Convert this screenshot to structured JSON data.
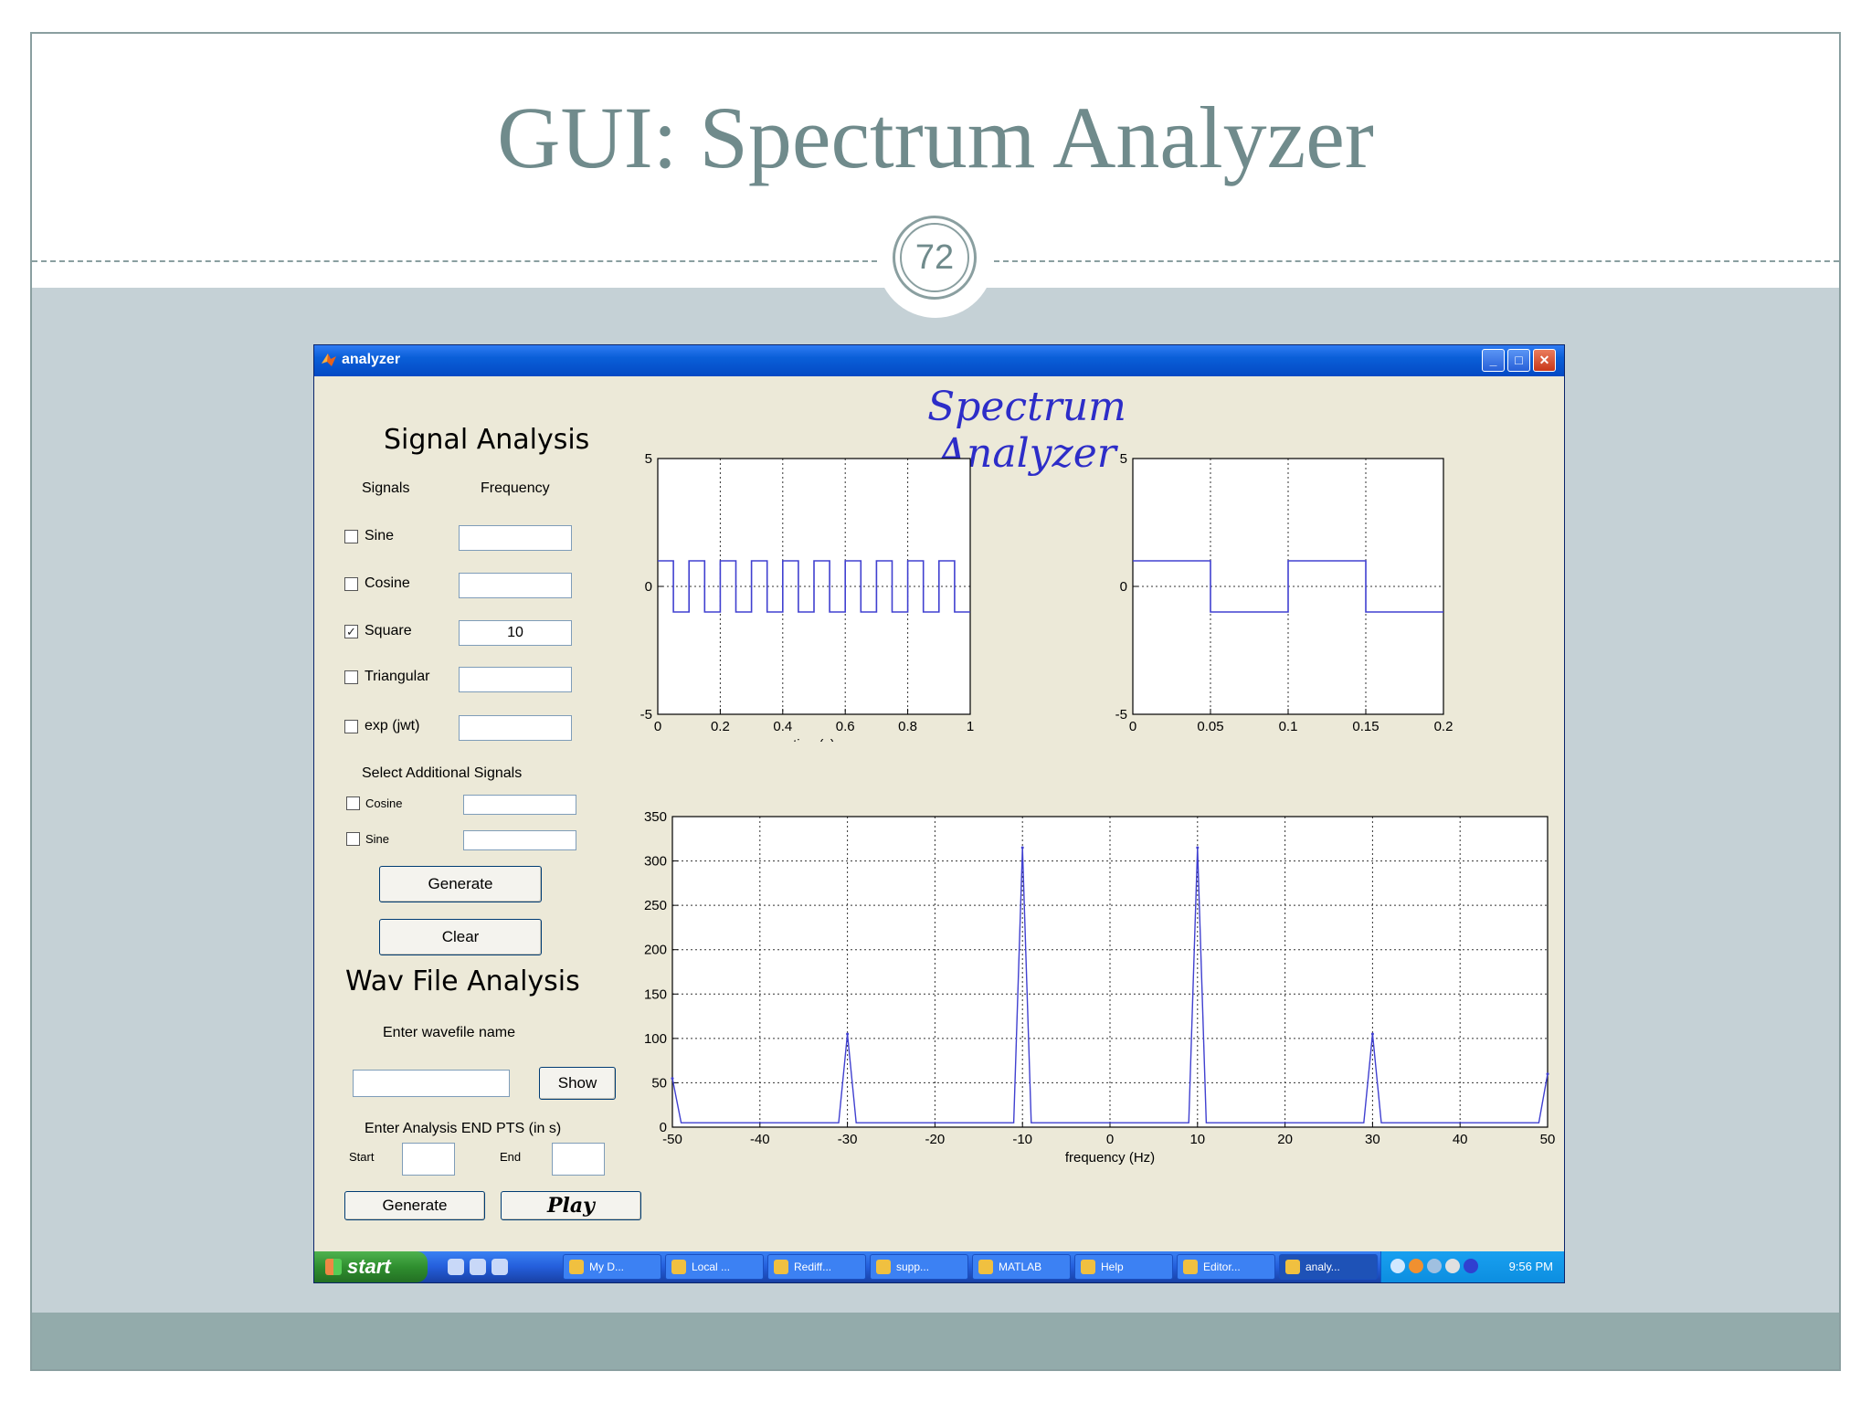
{
  "slide": {
    "title": "GUI: Spectrum Analyzer",
    "page_number": "72",
    "colors": {
      "title": "#708b8c",
      "content_bg": "#c5d1d6",
      "footer": "#93abab"
    }
  },
  "window": {
    "title": "analyzer",
    "icon": "matlab-icon",
    "controls": {
      "minimize": "minimize-icon",
      "maximize": "maximize-icon",
      "close": "close-icon"
    }
  },
  "app": {
    "heading": "Spectrum Analyzer",
    "signal_analysis": {
      "title": "Signal Analysis",
      "col_signals": "Signals",
      "col_frequency": "Frequency",
      "signals": [
        {
          "label": "Sine",
          "checked": false,
          "frequency": ""
        },
        {
          "label": "Cosine",
          "checked": false,
          "frequency": ""
        },
        {
          "label": "Square",
          "checked": true,
          "frequency": "10"
        },
        {
          "label": "Triangular",
          "checked": false,
          "frequency": ""
        },
        {
          "label": "exp (jwt)",
          "checked": false,
          "frequency": ""
        }
      ],
      "additional_title": "Select Additional Signals",
      "additional": [
        {
          "label": "Cosine",
          "checked": false,
          "value": ""
        },
        {
          "label": "Sine",
          "checked": false,
          "value": ""
        }
      ],
      "generate_label": "Generate",
      "clear_label": "Clear"
    },
    "wav_analysis": {
      "title": "Wav File Analysis",
      "prompt": "Enter wavefile name",
      "filename": "",
      "show_label": "Show",
      "pts_prompt": "Enter Analysis END PTS (in s)",
      "start_label": "Start",
      "start_value": "",
      "end_label": "End",
      "end_value": "",
      "generate_label": "Generate",
      "play_label": "Play"
    }
  },
  "chart_data": [
    {
      "type": "line",
      "x_ticks": [
        "0",
        "0.2",
        "0.4",
        "0.6",
        "0.8",
        "1"
      ],
      "y_ticks": [
        "5",
        "0",
        "-5"
      ],
      "xlabel": "time(s)",
      "xlim": [
        0,
        1
      ],
      "ylim": [
        -5,
        5
      ],
      "grid": true,
      "series": [
        {
          "description": "square wave",
          "frequency_hz": 10,
          "amplitude": 1,
          "color": "#4040d0"
        }
      ]
    },
    {
      "type": "line",
      "x_ticks": [
        "0",
        "0.05",
        "0.1",
        "0.15",
        "0.2"
      ],
      "y_ticks": [
        "5",
        "0",
        "-5"
      ],
      "xlabel": "",
      "xlim": [
        0,
        0.2
      ],
      "ylim": [
        -5,
        5
      ],
      "grid": true,
      "series": [
        {
          "description": "square wave zoom",
          "frequency_hz": 10,
          "amplitude": 1,
          "color": "#4040d0"
        }
      ]
    },
    {
      "type": "line",
      "x_ticks": [
        "-50",
        "-40",
        "-30",
        "-20",
        "-10",
        "0",
        "10",
        "20",
        "30",
        "40",
        "50"
      ],
      "y_ticks": [
        "350",
        "300",
        "250",
        "200",
        "150",
        "100",
        "50",
        "0"
      ],
      "xlabel": "frequency (Hz)",
      "xlim": [
        -50,
        50
      ],
      "ylim": [
        0,
        350
      ],
      "grid": true,
      "baseline": 5,
      "peaks": [
        {
          "x": -50,
          "y": 55
        },
        {
          "x": -30,
          "y": 105
        },
        {
          "x": -10,
          "y": 315
        },
        {
          "x": 10,
          "y": 315
        },
        {
          "x": 30,
          "y": 105
        },
        {
          "x": 50,
          "y": 60
        }
      ],
      "color": "#4040d0"
    }
  ],
  "taskbar": {
    "start_label": "start",
    "tasks": [
      "My D...",
      "Local ...",
      "Rediff...",
      "supp...",
      "MATLAB",
      "Help",
      "Editor...",
      "analy..."
    ],
    "active_task": "analy...",
    "clock": "9:56 PM"
  }
}
